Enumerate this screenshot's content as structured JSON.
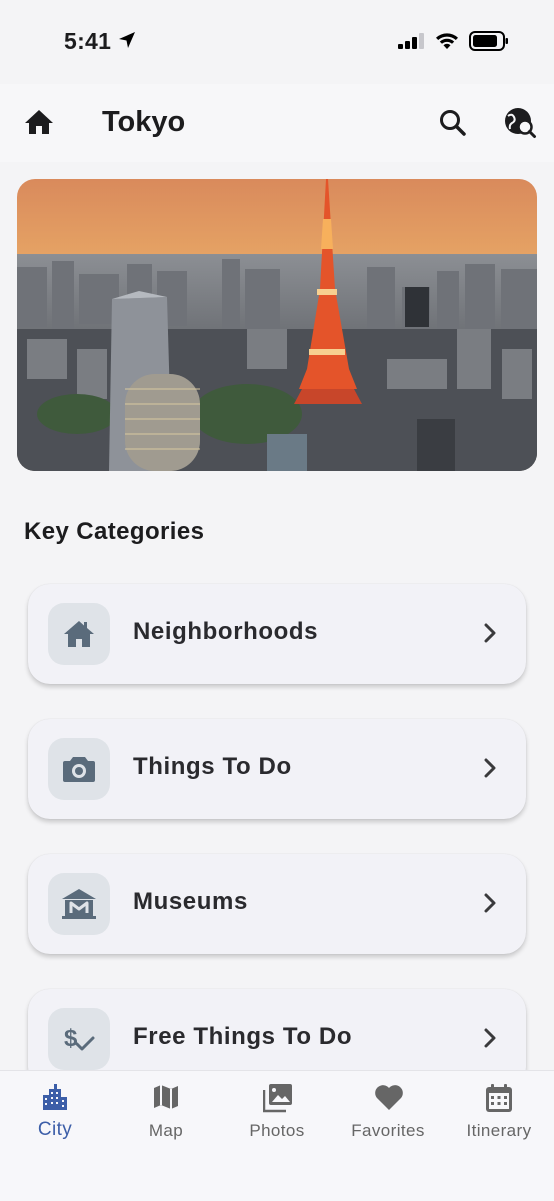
{
  "status_bar": {
    "time": "5:41"
  },
  "header": {
    "title": "Tokyo"
  },
  "hero": {
    "alt": "Tokyo skyline with Tokyo Tower at sunset"
  },
  "section": {
    "title": "Key Categories"
  },
  "categories": [
    {
      "label": "Neighborhoods",
      "icon": "house-icon"
    },
    {
      "label": "Things To Do",
      "icon": "camera-icon"
    },
    {
      "label": "Museums",
      "icon": "museum-icon"
    },
    {
      "label": "Free Things To Do",
      "icon": "dollar-check-icon"
    }
  ],
  "nav": {
    "items": [
      {
        "label": "City",
        "icon": "city-icon",
        "active": true
      },
      {
        "label": "Map",
        "icon": "map-icon",
        "active": false
      },
      {
        "label": "Photos",
        "icon": "photos-icon",
        "active": false
      },
      {
        "label": "Favorites",
        "icon": "heart-icon",
        "active": false
      },
      {
        "label": "Itinerary",
        "icon": "calendar-icon",
        "active": false
      }
    ]
  },
  "colors": {
    "accent": "#3c5ea8",
    "icon_tile": "#dfe3e8",
    "icon": "#5a6b7b",
    "background": "#f4f4f6"
  }
}
